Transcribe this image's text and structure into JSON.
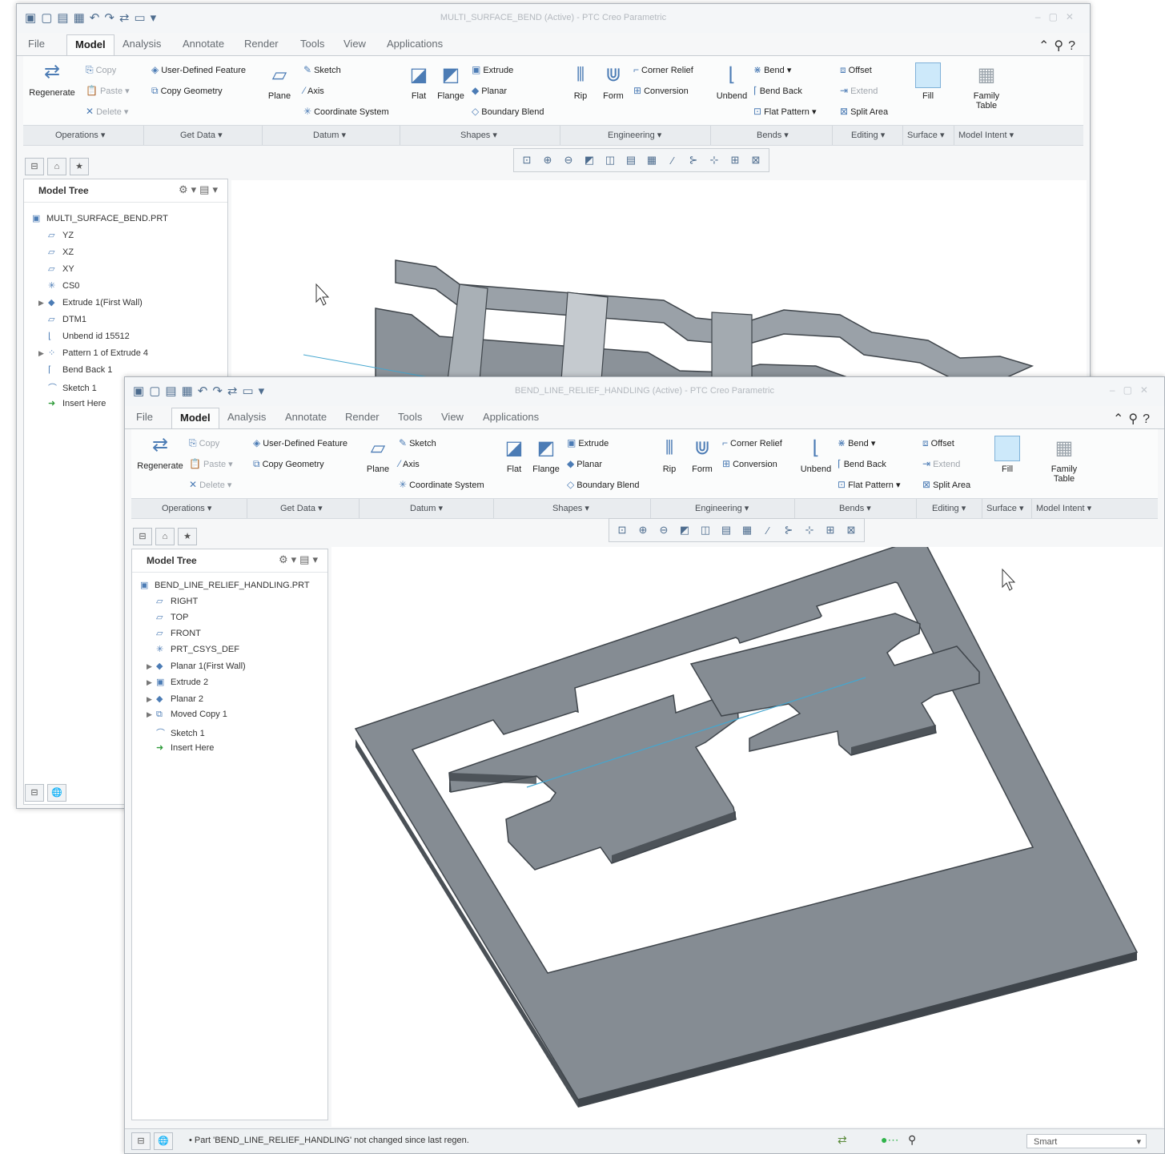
{
  "window_back": {
    "title": "MULTI_SURFACE_BEND (Active) - PTC Creo Parametric",
    "tree": {
      "root": "MULTI_SURFACE_BEND.PRT",
      "items": [
        "YZ",
        "XZ",
        "XY",
        "CS0",
        "Extrude 1(First Wall)",
        "DTM1",
        "Unbend id 15512",
        "Pattern 1 of Extrude 4",
        "Bend Back 1",
        "Sketch 1",
        "Insert Here"
      ]
    }
  },
  "window_front": {
    "title": "BEND_LINE_RELIEF_HANDLING (Active) - PTC Creo Parametric",
    "tree": {
      "root": "BEND_LINE_RELIEF_HANDLING.PRT",
      "items": [
        "RIGHT",
        "TOP",
        "FRONT",
        "PRT_CSYS_DEF",
        "Planar 1(First Wall)",
        "Extrude 2",
        "Planar 2",
        "Moved Copy 1",
        "Sketch 1",
        "Insert Here"
      ]
    },
    "status_message": "Part 'BEND_LINE_RELIEF_HANDLING' not changed since last regen.",
    "filter_value": "Smart"
  },
  "tabs": [
    "File",
    "Model",
    "Analysis",
    "Annotate",
    "Render",
    "Tools",
    "View",
    "Applications"
  ],
  "model_tree_label": "Model Tree",
  "ribbon": {
    "regenerate": "Regenerate",
    "copy": "Copy",
    "paste": "Paste",
    "delete": "Delete",
    "user_defined_feature": "User-Defined Feature",
    "copy_geometry": "Copy Geometry",
    "plane": "Plane",
    "sketch": "Sketch",
    "axis": "Axis",
    "coordinate_system": "Coordinate System",
    "flat": "Flat",
    "flange": "Flange",
    "extrude": "Extrude",
    "planar": "Planar",
    "boundary_blend": "Boundary Blend",
    "rip": "Rip",
    "form": "Form",
    "corner_relief": "Corner Relief",
    "conversion": "Conversion",
    "unbend": "Unbend",
    "bend": "Bend",
    "bend_back": "Bend Back",
    "flat_pattern": "Flat Pattern",
    "offset": "Offset",
    "extend": "Extend",
    "split_area": "Split Area",
    "fill": "Fill",
    "family_table": "Family Table"
  },
  "groups": [
    "Operations",
    "Get Data",
    "Datum",
    "Shapes",
    "Engineering",
    "Bends",
    "Editing",
    "Surface",
    "Model Intent"
  ],
  "icons": [
    "new-icon",
    "open-icon",
    "save-icon",
    "undo-icon",
    "redo-icon",
    "regenerate-icon",
    "window-icon",
    "zoom-icon",
    "search-icon",
    "help-icon",
    "cursor-icon"
  ],
  "colors": {
    "accent": "#4c7cb5",
    "part_gray": "#858c93",
    "part_edge": "#3f454b",
    "bend_line": "#45a6cf"
  }
}
